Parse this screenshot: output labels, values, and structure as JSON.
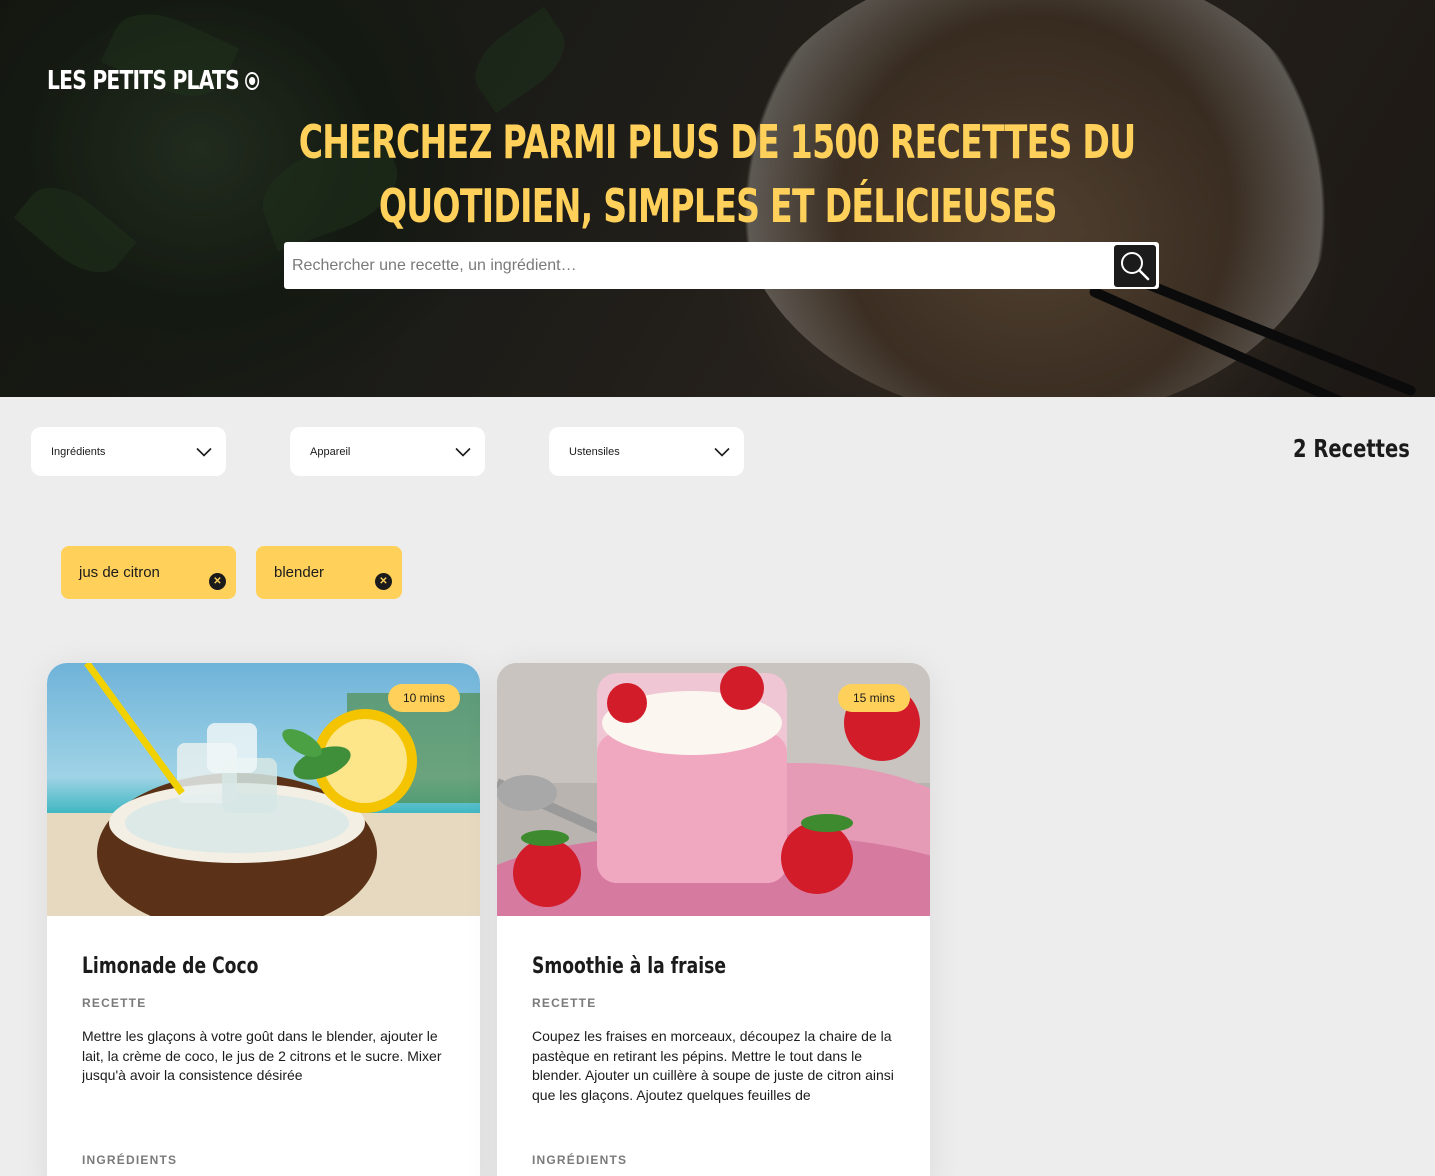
{
  "header": {
    "logo": "LES PETITS PLATS",
    "headline_line1": "CHERCHEZ PARMI PLUS DE 1500 RECETTES DU",
    "headline_line2": "QUOTIDIEN, SIMPLES ET DÉLICIEUSES",
    "search": {
      "placeholder": "Rechercher une recette, un ingrédient…",
      "value": "",
      "button_icon": "search-icon"
    }
  },
  "filters": {
    "dropdowns": [
      {
        "label": "Ingrédients",
        "icon": "chevron-down-icon"
      },
      {
        "label": "Appareil",
        "icon": "chevron-down-icon"
      },
      {
        "label": "Ustensiles",
        "icon": "chevron-down-icon"
      }
    ],
    "recipe_count": "2 Recettes",
    "active_tags": [
      {
        "label": "jus de citron",
        "icon": "close-icon"
      },
      {
        "label": "blender",
        "icon": "close-icon"
      }
    ]
  },
  "recipes": [
    {
      "time": "10 mins",
      "title": "Limonade de Coco",
      "section_recipe": "RECETTE",
      "description": "Mettre les glaçons à votre goût dans le blender, ajouter le lait, la crème de coco, le jus de 2 citrons et le sucre. Mixer jusqu'à avoir la consistence désirée",
      "section_ingredients": "INGRÉDIENTS"
    },
    {
      "time": "15 mins",
      "title": "Smoothie à la fraise",
      "section_recipe": "RECETTE",
      "description": "Coupez les fraises en morceaux, découpez la chaire de la pastèque en retirant les pépins. Mettre le tout dans le blender. Ajouter un cuillère à soupe de juste de citron ainsi que les glaçons. Ajoutez quelques feuilles de",
      "section_ingredients": "INGRÉDIENTS"
    }
  ],
  "colors": {
    "accent": "#ffd15b",
    "dark": "#1b1b1b",
    "background": "#ededed",
    "muted": "#7a7a7a"
  }
}
